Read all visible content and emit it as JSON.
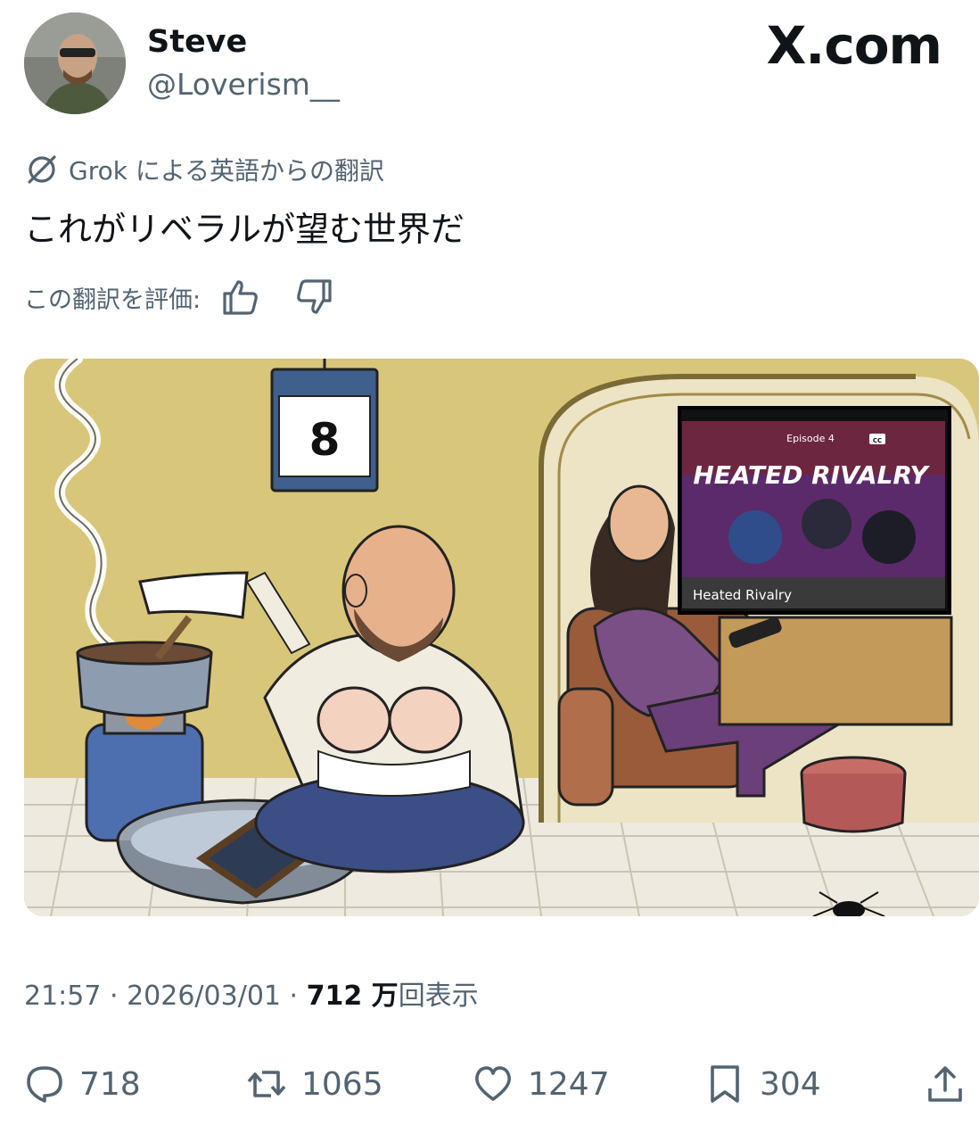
{
  "author": {
    "name": "Steve",
    "handle": "@Loverism__"
  },
  "brand": {
    "label": "X.com"
  },
  "translation": {
    "label": "Grok による英語からの翻訳",
    "text": "これがリベラルが望む世界だ",
    "rate_label": "この翻訳を評価:"
  },
  "media": {
    "calendar_number": "8",
    "tv": {
      "episode": "Episode 4",
      "cc": "CC",
      "title": "HEATED RIVALRY",
      "caption": "Heated Rivalry"
    }
  },
  "meta": {
    "time": "21:57",
    "sep1": " · ",
    "date": "2026/03/01",
    "sep2": " · ",
    "views_count": "712 万",
    "views_label": "回表示"
  },
  "actions": {
    "replies": "718",
    "reposts": "1065",
    "likes": "1247",
    "bookmarks": "304"
  },
  "colors": {
    "text": "#0f1419",
    "secondary": "#536471",
    "wall": "#d8c77a",
    "sweater": "#7a4f86",
    "armchair": "#9a5b3b"
  },
  "icons": [
    "grok-icon",
    "thumbs-up-icon",
    "thumbs-down-icon",
    "reply-icon",
    "repost-icon",
    "like-icon",
    "bookmark-icon",
    "share-icon"
  ]
}
